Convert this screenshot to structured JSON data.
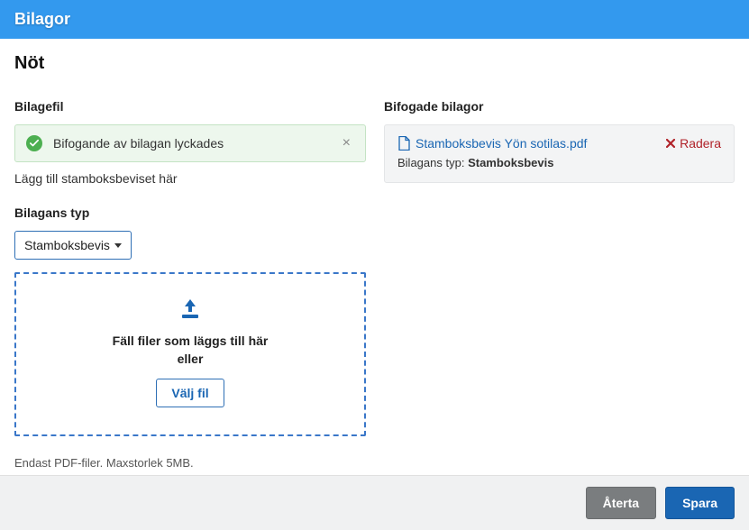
{
  "header": {
    "title": "Bilagor"
  },
  "page": {
    "title": "Nöt"
  },
  "left": {
    "section_label": "Bilagefil",
    "alert": {
      "text": "Bifogande av bilagan lyckades"
    },
    "hint": "Lägg till stamboksbeviset här",
    "type_label": "Bilagans typ",
    "type_selected": "Stamboksbevis",
    "dropzone": {
      "line1": "Fäll filer som läggs till här",
      "line2": "eller",
      "choose": "Välj fil"
    },
    "filehint": "Endast PDF-filer. Maxstorlek 5MB."
  },
  "right": {
    "section_label": "Bifogade bilagor",
    "attachment": {
      "filename": "Stamboksbevis Yön sotilas.pdf",
      "type_label": "Bilagans typ:",
      "type_value": "Stamboksbevis",
      "delete": "Radera"
    }
  },
  "footer": {
    "revert": "Återta",
    "save": "Spara"
  }
}
